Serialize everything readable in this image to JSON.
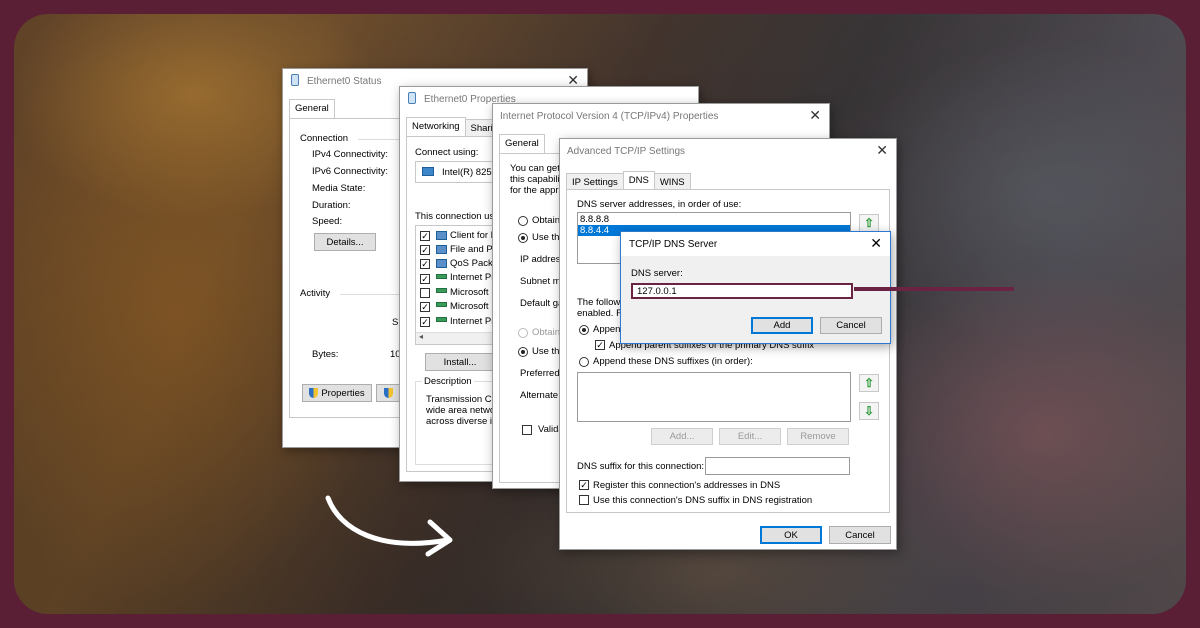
{
  "colors": {
    "brand_bg": "#5a1f35",
    "highlight": "#6a2342",
    "selection": "#0078d7"
  },
  "status_window": {
    "title": "Ethernet0 Status",
    "tab": "General",
    "connection_heading": "Connection",
    "rows": [
      "IPv4 Connectivity:",
      "IPv6 Connectivity:",
      "Media State:",
      "Duration:",
      "Speed:"
    ],
    "details_button": "Details...",
    "activity_heading": "Activity",
    "activity_s": "S",
    "bytes_label": "Bytes:",
    "bytes_value": "10",
    "properties_button": "Properties"
  },
  "props_window": {
    "title": "Ethernet0 Properties",
    "tabs": [
      "Networking",
      "Sharing"
    ],
    "connect_using": "Connect using:",
    "adapter": "Intel(R) 8257",
    "uses_label": "This connection use",
    "items": [
      "Client for M",
      "File and P",
      "QoS Pack",
      "Internet Pr",
      "Microsoft I",
      "Microsoft I",
      "Internet Pr"
    ],
    "install_button": "Install...",
    "description_heading": "Description",
    "description_lines": [
      "Transmission Con",
      "wide area netwo",
      "across diverse in"
    ]
  },
  "ipv4_window": {
    "title": "Internet Protocol Version 4 (TCP/IPv4) Properties",
    "tab": "General",
    "intro_lines": [
      "You can get",
      "this capabili",
      "for the appr"
    ],
    "obtain_auto": "Obtain",
    "use_following": "Use the",
    "ip_address": "IP address",
    "subnet": "Subnet m",
    "gateway": "Default ga",
    "obtain_dns": "Obtain",
    "use_dns": "Use the",
    "preferred": "Preferred",
    "alternate": "Alternate",
    "validate": "Valida"
  },
  "advanced_window": {
    "title": "Advanced TCP/IP Settings",
    "tabs": [
      "IP Settings",
      "DNS",
      "WINS"
    ],
    "dns_list_label": "DNS server addresses, in order of use:",
    "dns_servers": [
      "8.8.8.8",
      "8.8.4.4"
    ],
    "following_lines": [
      "The followi",
      "enabled. F"
    ],
    "append_primary": "Append",
    "append_parent": "Append parent suffixes of the primary DNS suffix",
    "append_these": "Append these DNS suffixes (in order):",
    "add_button": "Add...",
    "edit_button": "Edit...",
    "remove_button": "Remove",
    "suffix_label": "DNS suffix for this connection:",
    "register_label": "Register this connection's addresses in DNS",
    "use_suffix_label": "Use this connection's DNS suffix in DNS registration",
    "ok_button": "OK",
    "cancel_button": "Cancel"
  },
  "dns_dialog": {
    "title": "TCP/IP DNS Server",
    "field_label": "DNS server:",
    "field_value": "127.0.0.1",
    "add_button": "Add",
    "cancel_button": "Cancel"
  }
}
